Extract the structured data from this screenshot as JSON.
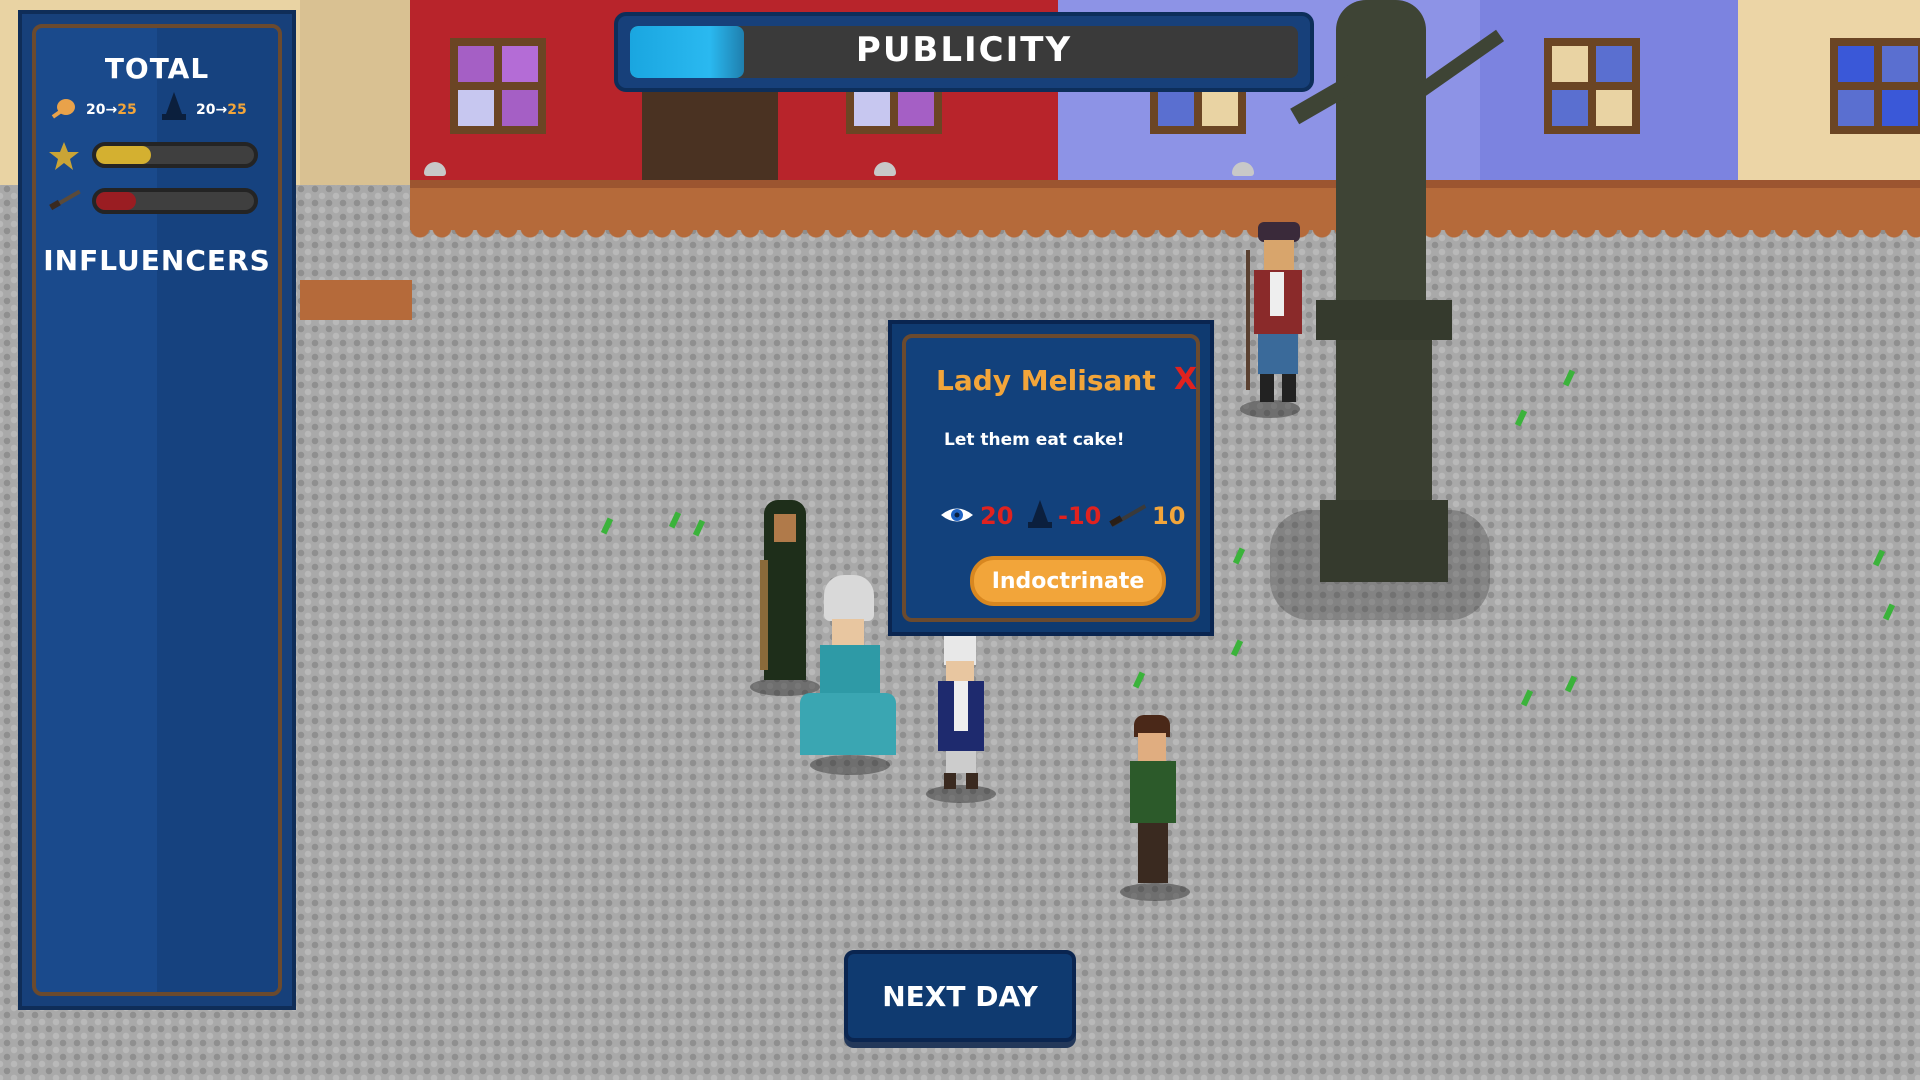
{
  "hud": {
    "total_title": "TOTAL",
    "food_stat": {
      "from": "20",
      "arrow": "→",
      "to": "25"
    },
    "clergy_stat": {
      "from": "20",
      "arrow": "→",
      "to": "25"
    },
    "fame_level": 0.35,
    "force_level": 0.25,
    "influencers_title": "INFLUENCERS"
  },
  "publicity": {
    "label": "PUBLICITY",
    "level": 0.17
  },
  "dialog": {
    "name": "Lady Melisant",
    "close_label": "X",
    "quote": "Let them eat cake!",
    "stats": [
      {
        "icon": "eye-icon",
        "value": "20",
        "color": "#e0221f"
      },
      {
        "icon": "clergy-hat-icon",
        "value": "-10",
        "color": "#e0221f"
      },
      {
        "icon": "musket-icon",
        "value": "10",
        "color": "#f2a53a"
      }
    ],
    "action_label": "Indoctrinate"
  },
  "next_day_label": "NEXT DAY",
  "colors": {
    "accent": "#f2a53a",
    "panel": "#17407a",
    "danger": "#e0221f"
  }
}
